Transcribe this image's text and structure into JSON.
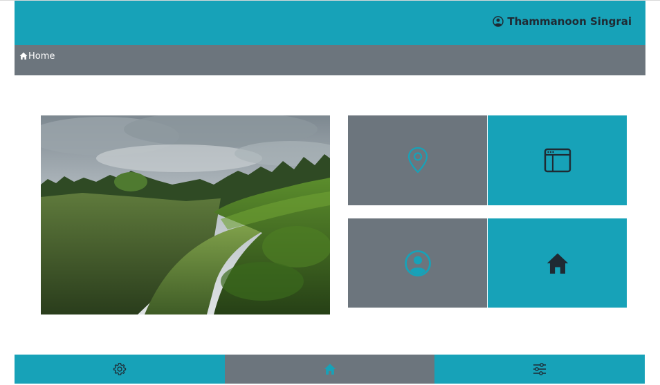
{
  "header": {
    "user_name": "Thammanoon Singrai",
    "user_icon": "user-circle-icon",
    "background": "#17a2b8"
  },
  "breadcrumb": {
    "home_label": "Home",
    "home_icon": "home-icon",
    "background": "#6c757d"
  },
  "hero_image": {
    "subject": "landscape-photo"
  },
  "tiles": [
    {
      "icon": "map-pin-icon",
      "color": "#6c757d"
    },
    {
      "icon": "browser-window-icon",
      "color": "#17a2b8"
    },
    {
      "icon": "user-circle-icon",
      "color": "#6c757d"
    },
    {
      "icon": "home-icon",
      "color": "#17a2b8"
    }
  ],
  "footer": {
    "items": [
      {
        "icon": "gear-icon"
      },
      {
        "icon": "home-icon"
      },
      {
        "icon": "sliders-icon"
      }
    ]
  },
  "colors": {
    "accent": "#17a2b8",
    "secondary": "#6c757d",
    "dark": "#1f2a33"
  }
}
